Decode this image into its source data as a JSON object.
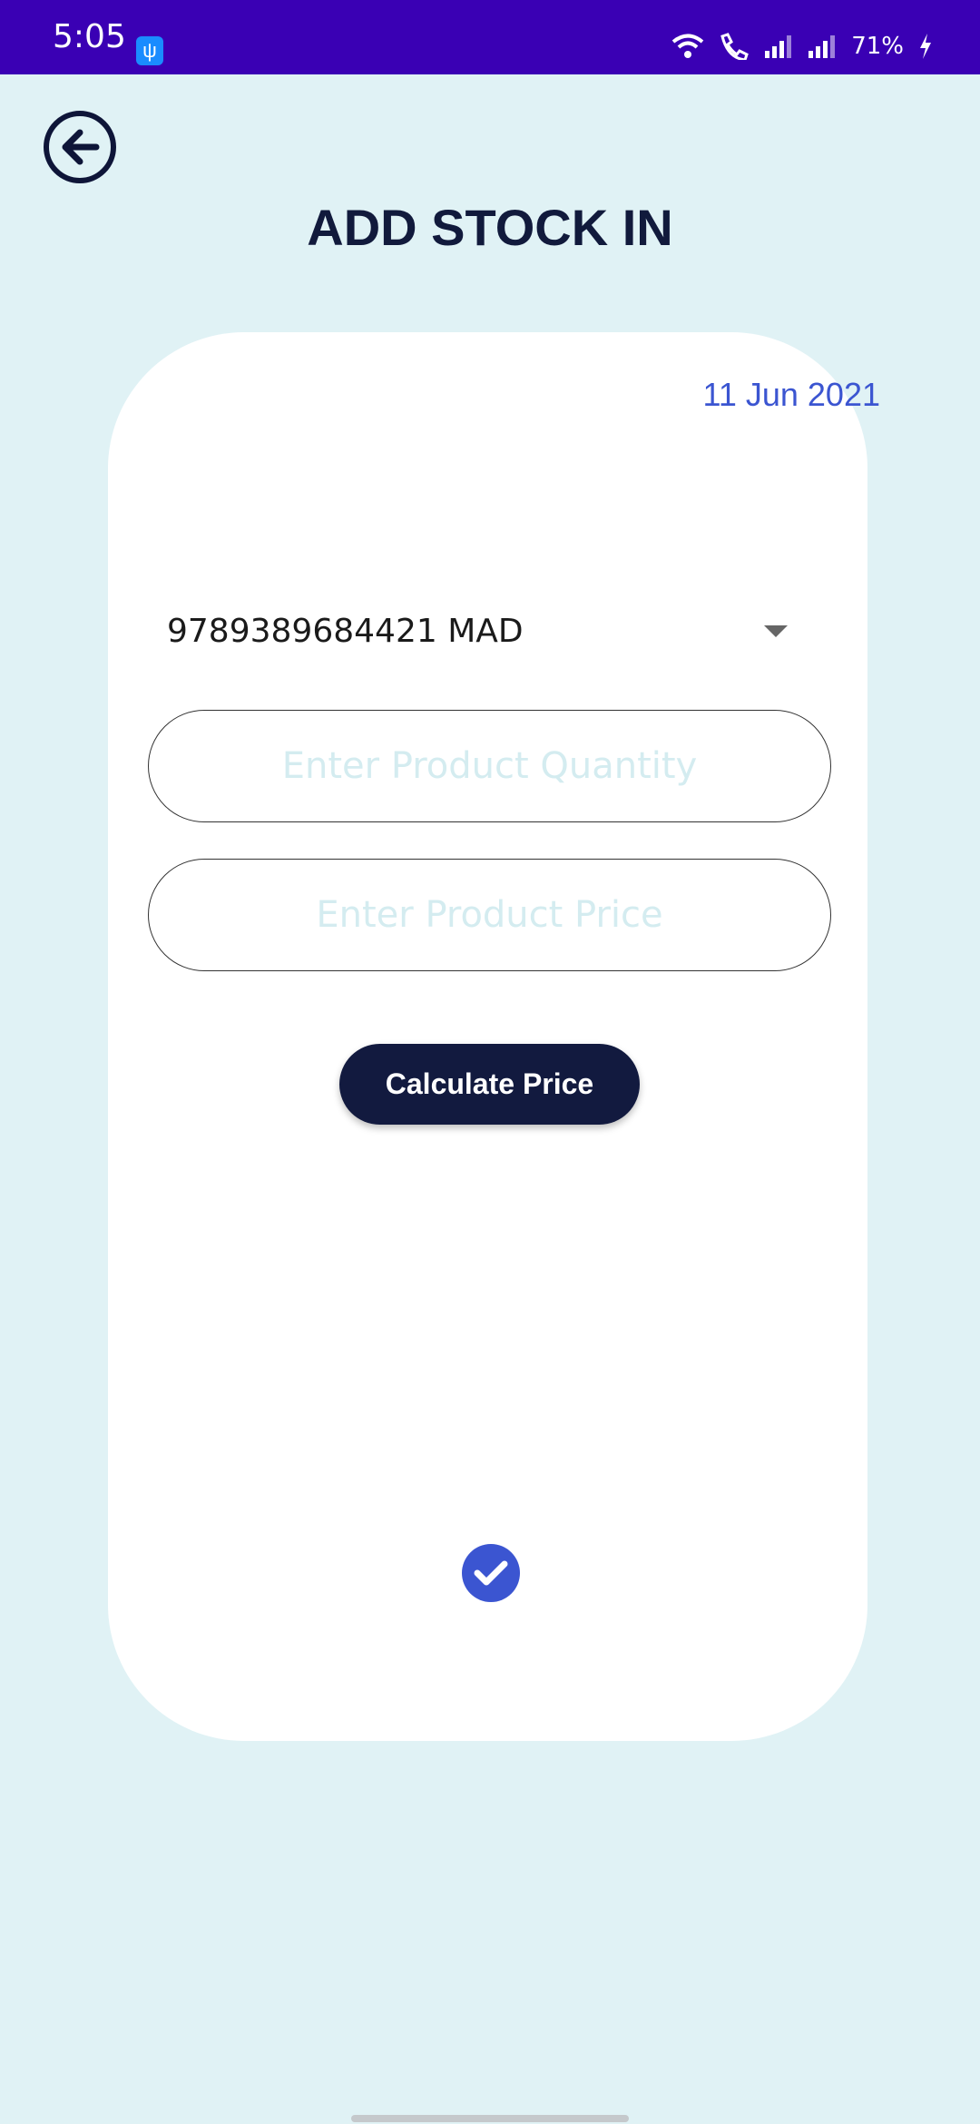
{
  "status_bar": {
    "time": "5:05",
    "usb_icon": "usb-icon",
    "battery_percent": "71%"
  },
  "header": {
    "title": "ADD STOCK IN",
    "back_icon": "arrow-left-circle-icon"
  },
  "card": {
    "date": "11 Jun 2021",
    "product_select_value": "9789389684421 MAD",
    "quantity_placeholder": "Enter Product Quantity",
    "price_placeholder": "Enter Product Price",
    "calculate_label": "Calculate Price",
    "confirm_icon": "check-circle-icon"
  },
  "colors": {
    "status_bar": "#3a00b4",
    "background": "#e0f2f5",
    "primary_dark": "#121a3f",
    "accent": "#3b55d1"
  }
}
